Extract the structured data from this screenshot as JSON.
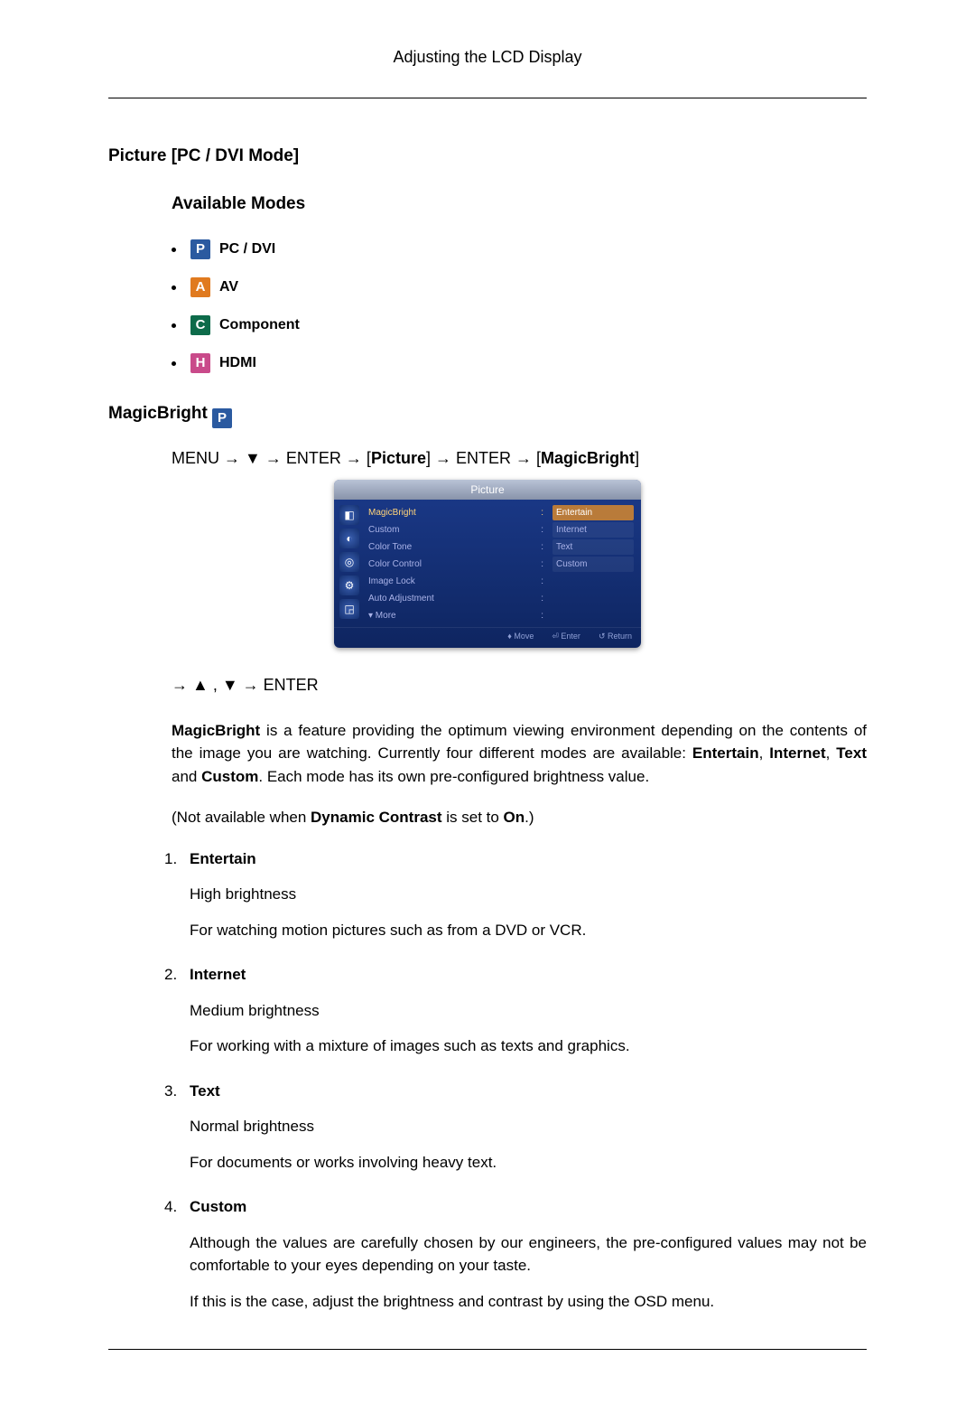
{
  "header": {
    "title": "Adjusting the LCD Display"
  },
  "section1_title": "Picture [PC / DVI Mode]",
  "section2_title": "Available Modes",
  "modes": [
    {
      "iconLetter": "P",
      "iconClass": "icon-p",
      "label": "PC / DVI"
    },
    {
      "iconLetter": "A",
      "iconClass": "icon-a",
      "label": "AV"
    },
    {
      "iconLetter": "C",
      "iconClass": "icon-c",
      "label": "Component"
    },
    {
      "iconLetter": "H",
      "iconClass": "icon-h",
      "label": "HDMI"
    }
  ],
  "magicbright_heading": "MagicBright",
  "nav": {
    "menu": "MENU",
    "enter": "ENTER",
    "arrow": "→",
    "down": "▼",
    "up": "▲",
    "picture": "Picture",
    "magicbright": "MagicBright"
  },
  "osd": {
    "title": "Picture",
    "navIcons": [
      "◧",
      "◐",
      "◎",
      "⚙",
      "◲"
    ],
    "menuItems": [
      {
        "label": "MagicBright",
        "selected": true
      },
      {
        "label": "Custom"
      },
      {
        "label": "Color Tone"
      },
      {
        "label": "Color Control"
      },
      {
        "label": "Image Lock"
      },
      {
        "label": "Auto Adjustment"
      },
      {
        "label": "▾ More"
      }
    ],
    "options": [
      {
        "label": "Entertain",
        "active": true
      },
      {
        "label": "Internet"
      },
      {
        "label": "Text"
      },
      {
        "label": "Custom"
      }
    ],
    "footer": {
      "move": "Move",
      "enter": "Enter",
      "return": "Return"
    }
  },
  "nav_continue": "→ ▲ , ▼ → ENTER",
  "desc_para_parts": {
    "bold1": "MagicBright",
    "t1": " is a feature providing the optimum viewing environment depending on the contents of the image you are watching. Currently four different modes are available: ",
    "bold2": "Entertain",
    "sep1": ", ",
    "bold3": "Internet",
    "sep2": ", ",
    "bold4": "Text",
    "sep3": " and ",
    "bold5": "Custom",
    "t2": ". Each mode has its own pre-configured brightness value."
  },
  "note_parts": {
    "t1": "(Not available when ",
    "b1": "Dynamic Contrast",
    "t2": " is set to ",
    "b2": "On",
    "t3": ".)"
  },
  "items": [
    {
      "title": "Entertain",
      "lines": [
        "High brightness",
        "For watching motion pictures such as from a DVD or VCR."
      ]
    },
    {
      "title": "Internet",
      "lines": [
        "Medium brightness",
        "For working with a mixture of images such as texts and graphics."
      ]
    },
    {
      "title": "Text",
      "lines": [
        "Normal brightness",
        "For documents or works involving heavy text."
      ]
    },
    {
      "title": "Custom",
      "lines": [
        "Although the values are carefully chosen by our engineers, the pre-configured values may not be comfortable to your eyes depending on your taste.",
        "If this is the case, adjust the brightness and contrast by using the OSD menu."
      ]
    }
  ]
}
